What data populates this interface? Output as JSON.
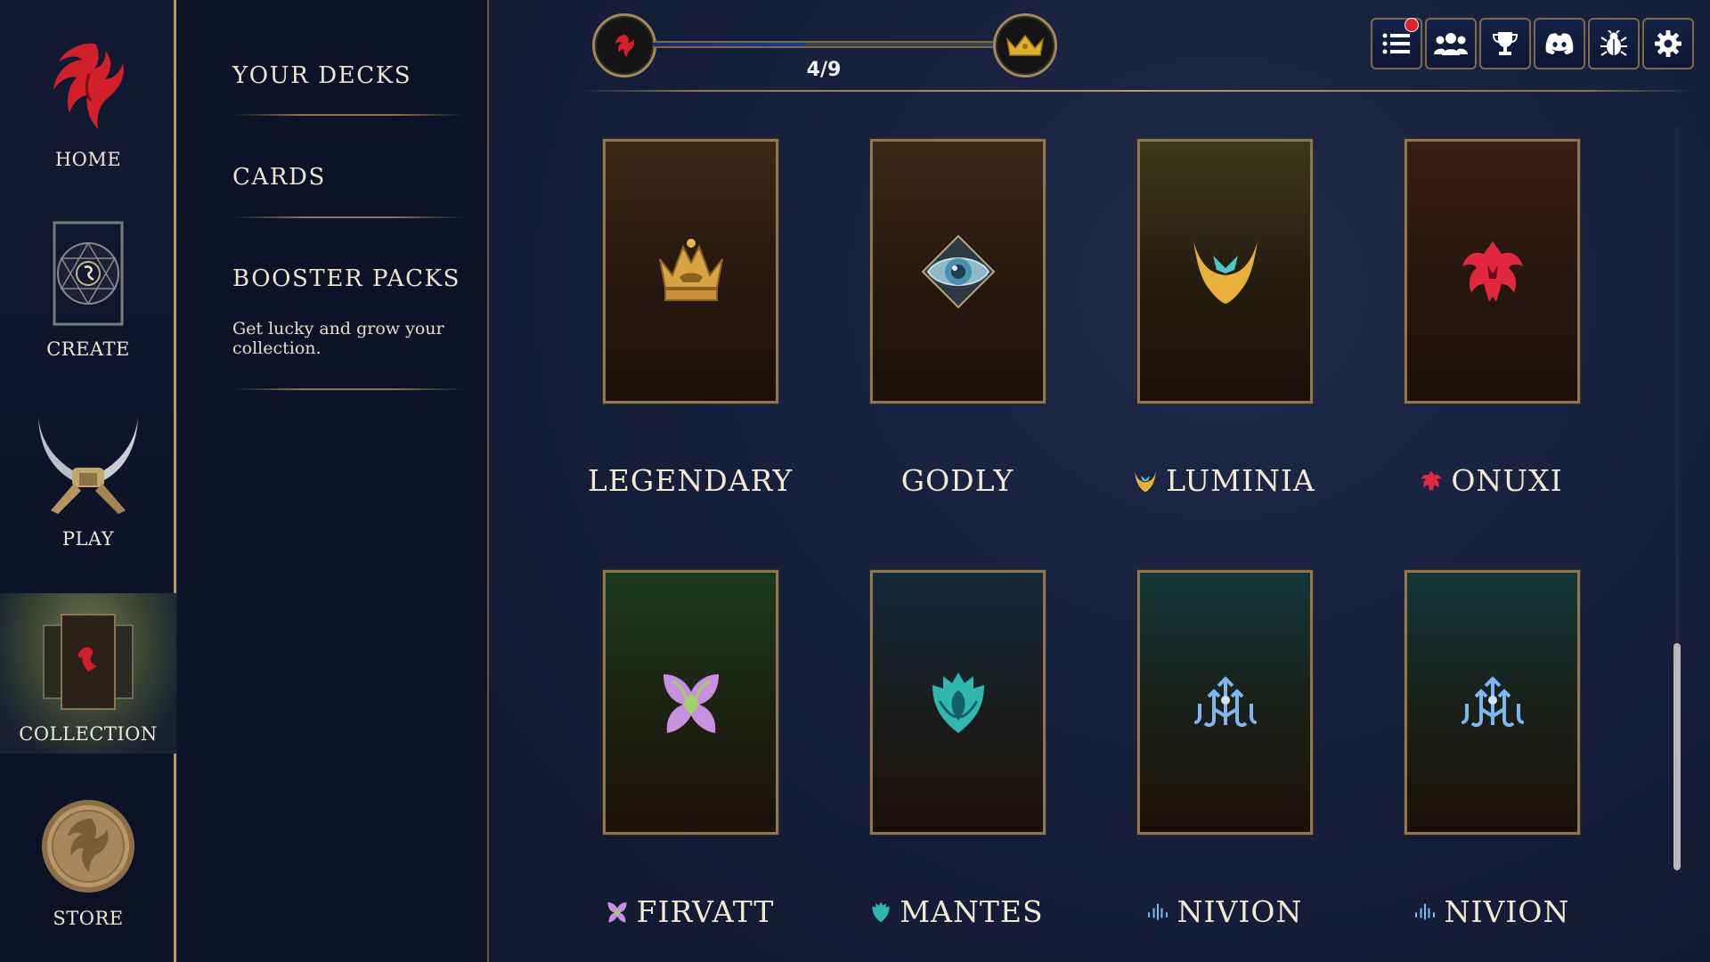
{
  "nav": {
    "home": "HOME",
    "create": "CREATE",
    "play": "PLAY",
    "collection": "COLLECTION",
    "store": "STORE"
  },
  "subnav": {
    "your_decks": "YOUR DECKS",
    "cards": "CARDS",
    "booster_packs": "BOOSTER PACKS",
    "booster_desc": "Get lucky and grow your collection."
  },
  "progress": {
    "text": "4/9",
    "current": 4,
    "total": 9
  },
  "toolbar": {
    "icons": [
      "list-icon",
      "friends-icon",
      "trophy-icon",
      "discord-icon",
      "bug-icon",
      "gear-icon"
    ],
    "has_notification": true
  },
  "packs": [
    {
      "label": "LEGENDARY",
      "icon": "crown-emblem-icon"
    },
    {
      "label": "GODLY",
      "icon": "eye-emblem-icon"
    },
    {
      "label": "LUMINIA",
      "icon": "luminia-emblem-icon"
    },
    {
      "label": "ONUXI",
      "icon": "onuxi-emblem-icon"
    },
    {
      "label": "FIRVATT",
      "icon": "firvatt-emblem-icon"
    },
    {
      "label": "MANTES",
      "icon": "mantes-emblem-icon"
    },
    {
      "label": "NIVION",
      "icon": "nivion-emblem-icon"
    },
    {
      "label": "NIVION",
      "icon": "nivion-emblem-icon"
    }
  ],
  "colors": {
    "gold": "#b59a63",
    "luminia": "#e0b347",
    "onuxi": "#d8233a",
    "firvatt": "#9fd36a",
    "mantes": "#2fb7b0",
    "nivion": "#7fb6ef",
    "notification": "#e0202a"
  }
}
